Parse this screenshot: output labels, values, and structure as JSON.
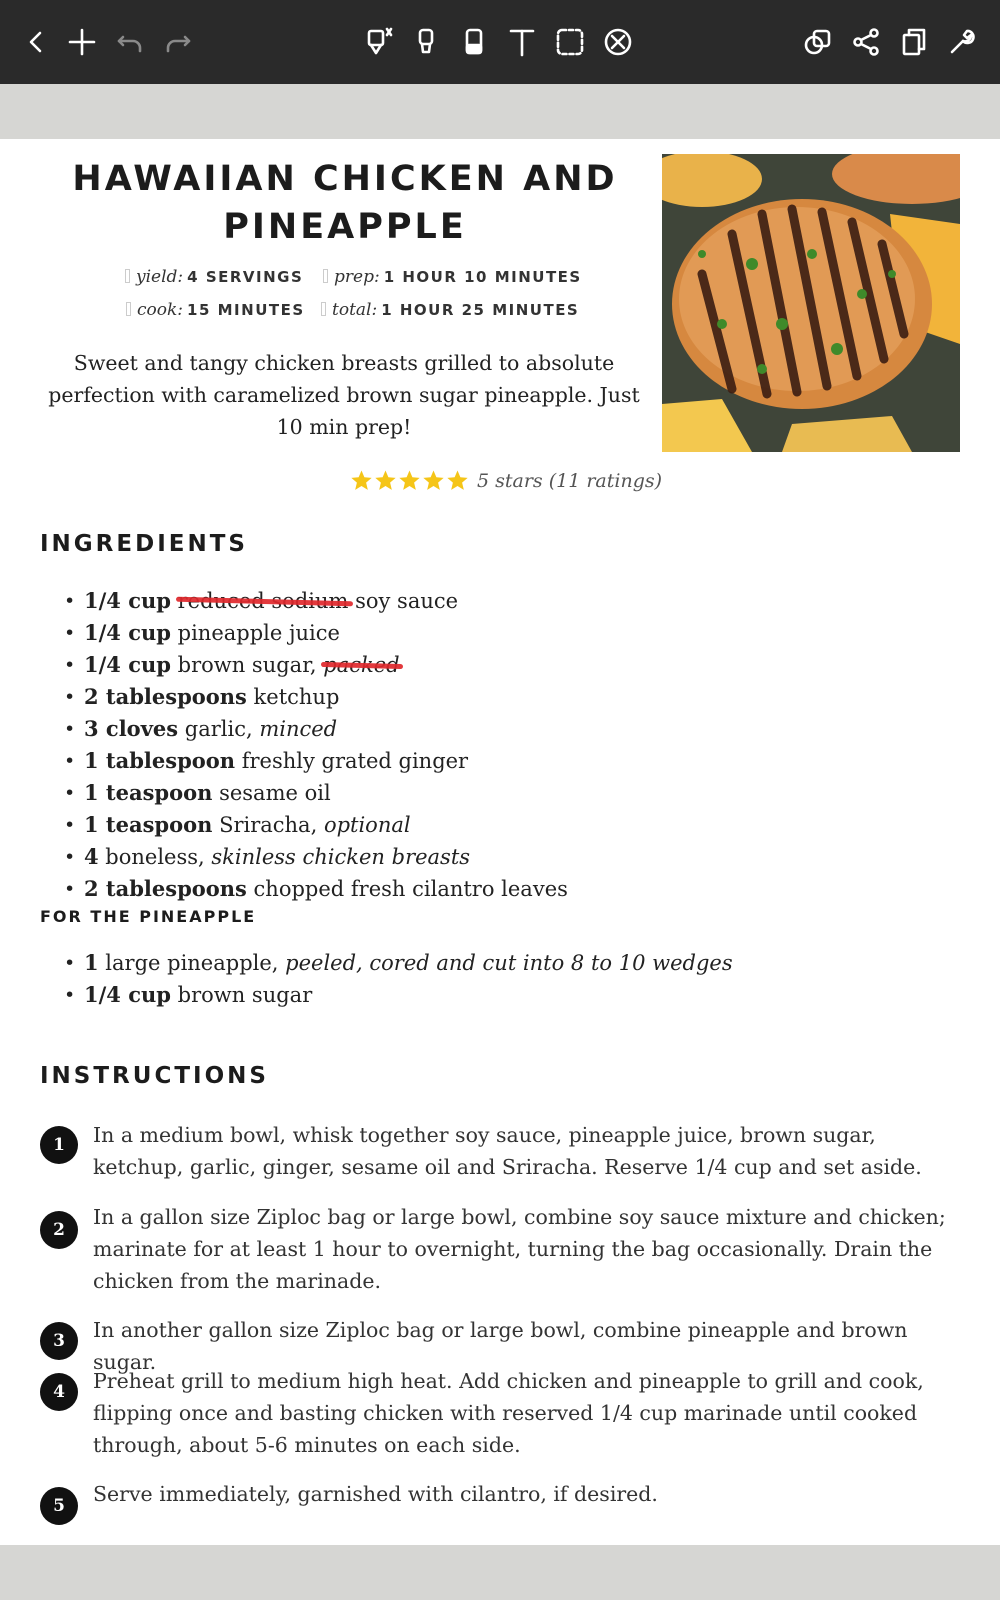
{
  "toolbar": {
    "left": [
      "back-icon",
      "add-icon",
      "undo-icon",
      "redo-icon"
    ],
    "center": [
      "pen-icon",
      "highlighter-icon",
      "eraser-icon",
      "text-icon",
      "lasso-select-icon",
      "shape-icon"
    ],
    "right": [
      "copy-icon",
      "share-icon",
      "pages-icon",
      "tools-icon"
    ]
  },
  "recipe": {
    "title_line1": "HAWAIIAN CHICKEN AND",
    "title_line2": "PINEAPPLE",
    "meta": {
      "yield_key": "yield:",
      "yield_val": "4 SERVINGS",
      "prep_key": "prep:",
      "prep_val": "1 HOUR 10 MINUTES",
      "cook_key": "cook:",
      "cook_val": "15 MINUTES",
      "total_key": "total:",
      "total_val": "1 HOUR 25 MINUTES"
    },
    "summary": "Sweet and tangy chicken breasts grilled to absolute perfection with caramelized brown sugar pineapple. Just 10 min prep!",
    "rating": {
      "stars": 5,
      "text": "5 stars (11 ratings)",
      "star_color": "#f5c518"
    },
    "ingredients_heading": "INGREDIENTS",
    "ingredients": [
      {
        "qty": "1/4 cup",
        "struck": "reduced sodium",
        "rest": " soy sauce"
      },
      {
        "qty": "1/4 cup",
        "rest": " pineapple juice"
      },
      {
        "qty": "1/4 cup",
        "rest": " brown sugar, ",
        "struck_after": "packed"
      },
      {
        "qty": "2 tablespoons",
        "rest": " ketchup"
      },
      {
        "qty": "3 cloves",
        "rest": " garlic, ",
        "note": "minced"
      },
      {
        "qty": "1 tablespoon",
        "rest": " freshly grated ginger"
      },
      {
        "qty": "1 teaspoon",
        "rest": " sesame oil"
      },
      {
        "qty": "1 teaspoon",
        "rest": " Sriracha, ",
        "note": "optional"
      },
      {
        "qty": "4",
        "rest": " boneless, ",
        "note": "skinless chicken breasts"
      },
      {
        "qty": "2 tablespoons",
        "rest": " chopped fresh cilantro leaves"
      }
    ],
    "pineapple_heading": "FOR THE PINEAPPLE",
    "pineapple": [
      {
        "qty": "1",
        "rest": " large pineapple, ",
        "note": "peeled, cored and cut into 8 to 10 wedges"
      },
      {
        "qty": "1/4 cup",
        "rest": " brown sugar"
      }
    ],
    "instructions_heading": "INSTRUCTIONS",
    "steps": [
      {
        "num": "1",
        "text": "In a medium bowl, whisk together soy sauce, pineapple juice, brown sugar, ketchup, garlic, ginger, sesame oil and Sriracha. Reserve 1/4 cup and set aside."
      },
      {
        "num": "2",
        "text": "In a gallon size Ziploc bag or large bowl, combine soy sauce mixture and chicken; marinate for at least 1 hour to overnight, turning the bag occasionally. Drain the chicken from the marinade."
      },
      {
        "num": "3",
        "text": "In another gallon size Ziploc bag or large bowl, combine pineapple and brown sugar."
      },
      {
        "num": "4",
        "text": "Preheat grill to medium high heat. Add chicken and pineapple to grill and cook, flipping once and basting chicken with reserved 1/4 cup marinade until cooked through, about 5-6 minutes on each side."
      },
      {
        "num": "5",
        "text": "Serve immediately, garnished with cilantro, if desired."
      }
    ]
  }
}
